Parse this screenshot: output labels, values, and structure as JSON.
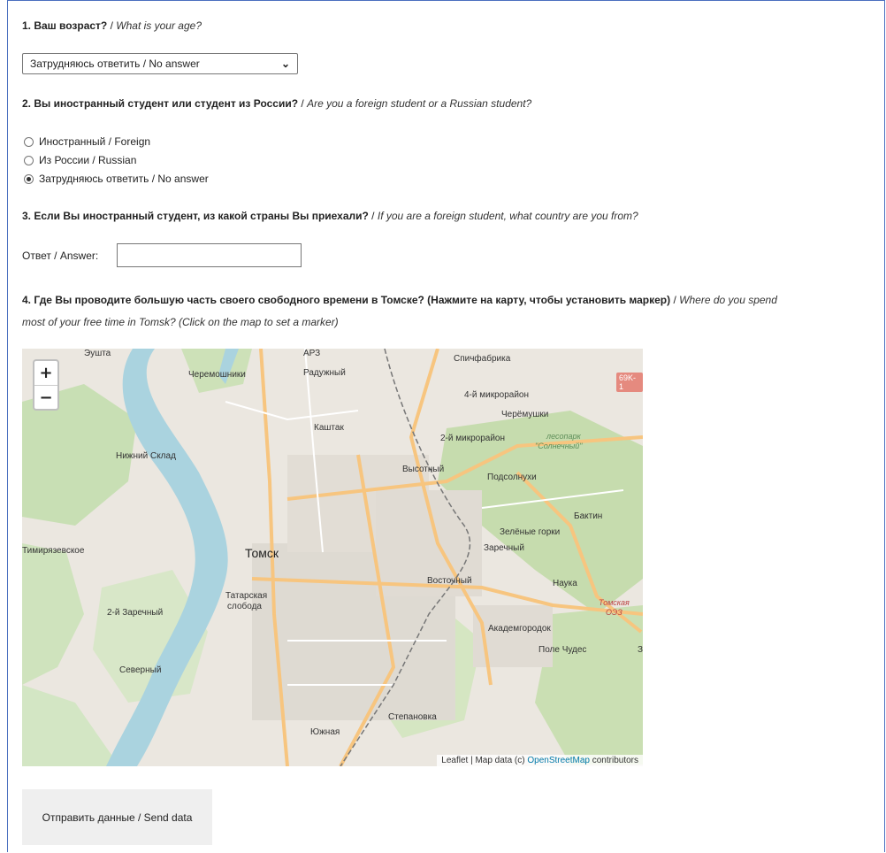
{
  "q1": {
    "title": "1. Ваш возраст?",
    "sep": " / ",
    "subtitle": "What is your age?",
    "selected": "Затрудняюсь ответить / No answer"
  },
  "q2": {
    "title": "2. Вы иностранный студент или студент из России?",
    "sep": " / ",
    "subtitle": "Are you a foreign student or a Russian student?",
    "options": [
      "Иностранный / Foreign",
      "Из России / Russian",
      "Затрудняюсь ответить / No answer"
    ],
    "selected_index": 2
  },
  "q3": {
    "title": "3. Если Вы иностранный студент, из какой страны Вы приехали?",
    "sep": " / ",
    "subtitle": "If you are a foreign student, what country are you from?",
    "answer_label": "Ответ / Answer:",
    "answer_value": ""
  },
  "q4": {
    "title": "4. Где Вы проводите большую часть своего свободного времени в Томске? (Нажмите на карту, чтобы установить маркер)",
    "sep": " / ",
    "subtitle_line1": "Where do you spend",
    "subtitle_line2": "most of your free time in Tomsk? (Click on the map to set a marker)"
  },
  "map": {
    "zoom_in": "+",
    "zoom_out": "−",
    "attribution_prefix": "Leaflet | Map data (c) ",
    "attribution_link": "OpenStreetMap",
    "attribution_suffix": " contributors",
    "shield": "69K-1",
    "labels": {
      "eushta": "Эушта",
      "ars": "АРЗ",
      "spichfabrika": "Спичфабрика",
      "cheremoshniki": "Черемошники",
      "raduzhny": "Радужный",
      "micro4": "4-й микрорайон",
      "cheremushki": "Черёмушки",
      "kashtak": "Каштак",
      "micro2": "2-й микрорайон",
      "lesopark1": "лесопарк",
      "lesopark2": "\"Солнечный\"",
      "nizhny_sklad": "Нижний Склад",
      "vysotny": "Высотный",
      "podsolnukhi": "Подсолнухи",
      "baktin": "Бактин",
      "zelenye_gorki": "Зелёные горки",
      "timiryazevskoe": "Тимирязевское",
      "tomsk": "Томск",
      "zarechny": "Заречный",
      "vostochny": "Восточный",
      "nauka": "Наука",
      "tatarskaya1": "Татарская",
      "tatarskaya2": "слобода",
      "tomskaya1": "Томская",
      "tomskaya2": "ОЭЗ",
      "zarechny2": "2-й Заречный",
      "akademgorodok": "Академгородок",
      "pole_chudes": "Поле Чудес",
      "z": "З",
      "severny": "Северный",
      "stepanovka": "Степановка",
      "yuzhnaya": "Южная"
    }
  },
  "submit": "Отправить данные / Send data"
}
